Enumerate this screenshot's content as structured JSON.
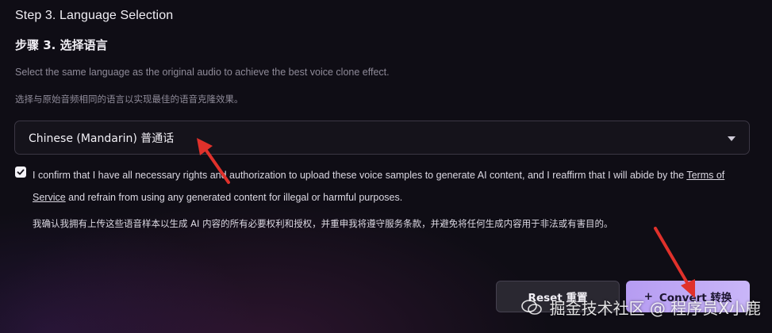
{
  "step": {
    "title_en": "Step 3. Language Selection",
    "title_cn": "步骤 3. 选择语言",
    "hint_en": "Select the same language as the original audio to achieve the best voice clone effect.",
    "hint_cn": "选择与原始音频相同的语言以实现最佳的语音克隆效果。"
  },
  "language_select": {
    "value": "Chinese (Mandarin) 普通话"
  },
  "consent": {
    "checked": true,
    "text_before": "I confirm that I have all necessary rights and authorization to upload these voice samples to generate AI content, and I reaffirm that I will abide by the ",
    "tos_link": "Terms of Service",
    "text_after": " and refrain from using any generated content for illegal or harmful purposes.",
    "text_cn": "我确认我拥有上传这些语音样本以生成 AI 内容的所有必要权利和授权，并重申我将遵守服务条款，并避免将任何生成内容用于非法或有害目的。"
  },
  "buttons": {
    "reset": "Reset 重置",
    "convert_icon": "+",
    "convert": "Convert 转换"
  },
  "watermark": {
    "text": "掘金技术社区 @ 程序员X小鹿"
  },
  "colors": {
    "background": "#0f0d15",
    "accent": "#b69cf2",
    "annotation_arrow": "#e0312b"
  },
  "icons": {
    "select_caret": "caret-down-icon",
    "checkbox": "check-icon",
    "convert": "plus-icon",
    "watermark": "wechat-icon"
  }
}
